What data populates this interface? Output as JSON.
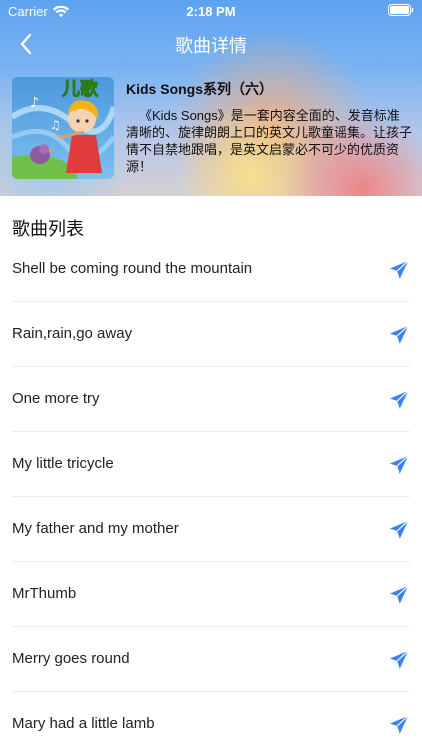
{
  "status_bar": {
    "carrier": "Carrier",
    "time": "2:18 PM"
  },
  "nav": {
    "title": "歌曲详情"
  },
  "album": {
    "title": "Kids Songs系列（六）",
    "description": "《Kids Songs》是一套内容全面的、发音标准清晰的、旋律朗朗上口的英文儿歌童谣集。让孩子情不自禁地跟唱，是英文启蒙必不可少的优质资源！",
    "cover_logo_text": "儿歌"
  },
  "list": {
    "header": "歌曲列表",
    "songs": [
      "Shell be coming round the mountain",
      "Rain,rain,go away",
      "One more try",
      "My little tricycle",
      "My father and my mother",
      "MrThumb",
      "Merry goes round",
      "Mary had a little lamb"
    ]
  },
  "colors": {
    "accent": "#3b82f6",
    "text": "#222222",
    "divider": "#ececec"
  },
  "icons": {
    "back": "chevron-left-icon",
    "send": "paper-plane-icon",
    "wifi": "wifi-icon",
    "battery": "battery-icon"
  }
}
